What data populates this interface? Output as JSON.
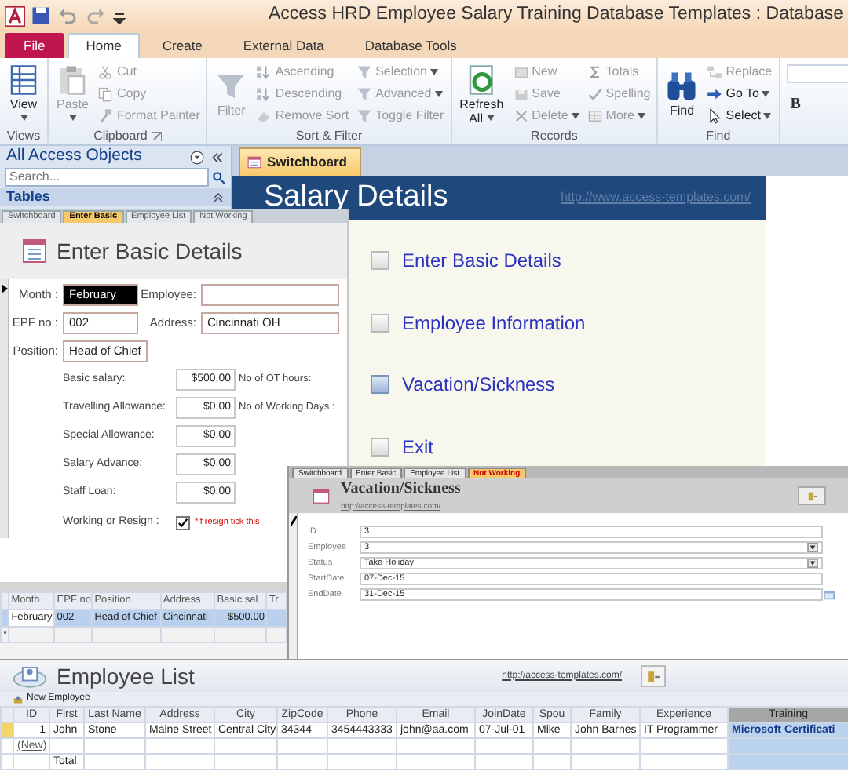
{
  "title_bar": {
    "title": "Access HRD Employee Salary Training Database Templates : Database"
  },
  "ribbon_tabs": [
    {
      "label": "File",
      "kind": "file",
      "selected": false
    },
    {
      "label": "Home",
      "kind": "tab",
      "selected": true
    },
    {
      "label": "Create",
      "kind": "tab",
      "selected": false
    },
    {
      "label": "External Data",
      "kind": "tab",
      "selected": false
    },
    {
      "label": "Database Tools",
      "kind": "tab",
      "selected": false
    }
  ],
  "ribbon_groups": [
    {
      "label": "Views",
      "large": [
        {
          "label": "View",
          "disabled": false,
          "dropdown": true
        }
      ]
    },
    {
      "label": "Clipboard",
      "launcher": true,
      "large": [
        {
          "label": "Paste",
          "disabled": true,
          "dropdown": true
        }
      ],
      "small": [
        {
          "label": "Cut",
          "disabled": true
        },
        {
          "label": "Copy",
          "disabled": true
        },
        {
          "label": "Format Painter",
          "disabled": true
        }
      ]
    },
    {
      "label": "Sort & Filter",
      "large": [
        {
          "label": "Filter",
          "disabled": true
        }
      ],
      "small": [
        {
          "label": "Ascending",
          "disabled": true
        },
        {
          "label": "Descending",
          "disabled": true
        },
        {
          "label": "Remove Sort",
          "disabled": true
        },
        {
          "label": "Selection",
          "disabled": true,
          "dropdown": true
        },
        {
          "label": "Advanced",
          "disabled": true,
          "dropdown": true
        },
        {
          "label": "Toggle Filter",
          "disabled": true
        }
      ]
    },
    {
      "label": "Records",
      "large": [
        {
          "label": "Refresh All",
          "disabled": false,
          "dropdown": true
        }
      ],
      "small": [
        {
          "label": "New",
          "disabled": true
        },
        {
          "label": "Save",
          "disabled": true
        },
        {
          "label": "Delete",
          "disabled": true,
          "dropdown": true
        },
        {
          "label": "Totals",
          "disabled": true
        },
        {
          "label": "Spelling",
          "disabled": true
        },
        {
          "label": "More",
          "disabled": true,
          "dropdown": true
        }
      ]
    },
    {
      "label": "Find",
      "large": [
        {
          "label": "Find",
          "disabled": false
        }
      ],
      "small": [
        {
          "label": "Replace",
          "disabled": true
        },
        {
          "label": "Go To",
          "disabled": false,
          "dropdown": true
        },
        {
          "label": "Select",
          "disabled": false,
          "dropdown": true
        }
      ]
    }
  ],
  "font_group": {
    "bold_label": "B"
  },
  "nav_pane": {
    "title": "All Access Objects",
    "search": {
      "placeholder": "Search..."
    },
    "section": "Tables"
  },
  "document_tabs": [
    {
      "label": "Switchboard",
      "selected": true
    }
  ],
  "switchboard": {
    "title": "Salary Details",
    "link": "http://www.access-templates.com/",
    "items": [
      {
        "label": "Enter Basic Details",
        "selected": false
      },
      {
        "label": "Employee Information",
        "selected": false
      },
      {
        "label": "Vacation/Sickness",
        "selected": true
      },
      {
        "label": "Exit",
        "selected": false
      }
    ]
  },
  "basic_form": {
    "tabs": [
      {
        "label": "Switchboard",
        "selected": false
      },
      {
        "label": "Enter Basic",
        "selected": true
      },
      {
        "label": "Employee List",
        "selected": false
      },
      {
        "label": "Not Working",
        "selected": false
      }
    ],
    "title": "Enter Basic Details",
    "fields": [
      {
        "label": "Month :",
        "value": "February",
        "selected": true
      },
      {
        "label": "Employee:",
        "selected": false
      },
      {
        "label": "EPF no :",
        "value": "002",
        "selected": false
      },
      {
        "label": "Address:",
        "value": "Cincinnati OH",
        "selected": false
      },
      {
        "label": "Position:",
        "value": "Head of Chief",
        "selected": false
      }
    ],
    "amounts": [
      {
        "label": "Basic salary:",
        "value": "$500.00",
        "side_label": "No of OT hours:"
      },
      {
        "label": "Travelling Allowance:",
        "value": "$0.00",
        "side_label": "No of Working Days :"
      },
      {
        "label": "Special Allowance:",
        "value": "$0.00"
      },
      {
        "label": "Salary Advance:",
        "value": "$0.00"
      },
      {
        "label": "Staff Loan:",
        "value": "$0.00"
      }
    ],
    "resign": {
      "label": "Working or Resign :",
      "checked": true,
      "note": "*if resign tick this"
    }
  },
  "datasheet": {
    "columns": [
      "Month",
      "EPF no",
      "Position",
      "Address",
      "Basic sal",
      "Tr"
    ],
    "rows": [
      [
        "February",
        "002",
        "Head of Chief",
        "Cincinnati",
        "$500.00"
      ]
    ],
    "new_row_marker": "*"
  },
  "vacation_form": {
    "tabs": [
      {
        "label": "Switchboard",
        "selected": false
      },
      {
        "label": "Enter Basic",
        "selected": false
      },
      {
        "label": "Employee List",
        "selected": false
      },
      {
        "label": "Not Working",
        "selected": true
      }
    ],
    "title": "Vacation/Sickness",
    "link": "http://access-templates.com/",
    "fields": [
      {
        "label": "ID",
        "value": "3",
        "kind": "text"
      },
      {
        "label": "Employee",
        "value": "3",
        "kind": "combo"
      },
      {
        "label": "Status",
        "value": "Take Holiday",
        "kind": "combo"
      },
      {
        "label": "StartDate",
        "value": "07-Dec-15",
        "kind": "text"
      },
      {
        "label": "EndDate",
        "value": "31-Dec-15",
        "kind": "date"
      }
    ]
  },
  "employee_list": {
    "title": "Employee List",
    "link": "http://access-templates.com/",
    "new_button": "New Employee",
    "columns": [
      {
        "label": "ID",
        "selected": false
      },
      {
        "label": "First",
        "selected": false
      },
      {
        "label": "Last Name",
        "selected": false
      },
      {
        "label": "Address",
        "selected": false
      },
      {
        "label": "City",
        "selected": false
      },
      {
        "label": "ZipCode",
        "selected": false
      },
      {
        "label": "Phone",
        "selected": false
      },
      {
        "label": "Email",
        "selected": false
      },
      {
        "label": "JoinDate",
        "selected": false
      },
      {
        "label": "Spou",
        "selected": false
      },
      {
        "label": "Family",
        "selected": false
      },
      {
        "label": "Experience",
        "selected": false
      },
      {
        "label": "Training",
        "selected": true
      }
    ],
    "rows": [
      {
        "cells": [
          "1",
          "John",
          "Stone",
          "Maine Street",
          "Central City",
          "34344",
          "3454443333",
          "john@aa.com",
          "07-Jul-01",
          "Mike",
          "John Barnes",
          "IT Programmer",
          "Microsoft Certificati"
        ],
        "selected": true
      }
    ],
    "new_row": "(New)",
    "total_label": "Total"
  }
}
